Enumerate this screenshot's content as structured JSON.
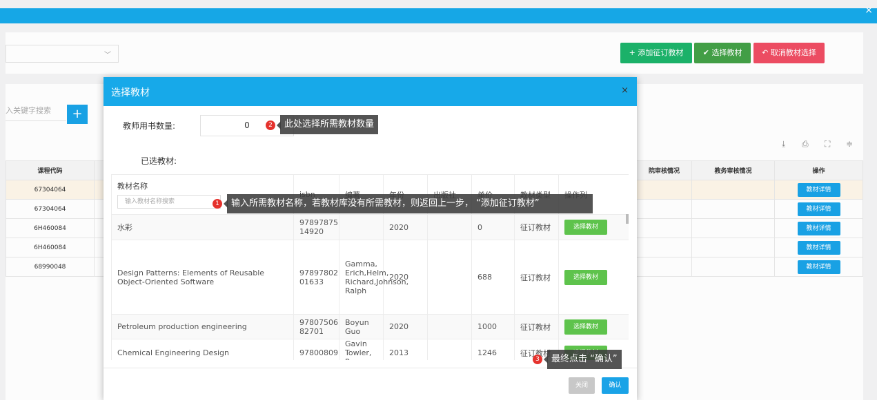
{
  "top": {
    "close_icon": "×"
  },
  "toolbar": {
    "add_label": "+ 添加征订教材",
    "select_label": "✔ 选择教材",
    "cancel_label": "↶ 取消教材选择"
  },
  "search": {
    "placeholder": "入关键字搜索",
    "add_icon": "+"
  },
  "bg_table": {
    "headers": {
      "code": "课程代码",
      "review1": "院审核情况",
      "review2": "教务审核情况",
      "action": "操作"
    },
    "rows": [
      {
        "code": "67304064",
        "action": "教材详情"
      },
      {
        "code": "67304064",
        "action": "教材详情"
      },
      {
        "code": "6H460084",
        "action": "教材详情"
      },
      {
        "code": "6H460084",
        "action": "教材详情"
      },
      {
        "code": "68990048",
        "action": "教材详情"
      }
    ]
  },
  "modal": {
    "title": "选择教材",
    "close": "×",
    "qty_label": "教师用书数量:",
    "qty_value": "0",
    "selected_label": "已选教材:",
    "columns": {
      "name": "教材名称",
      "isbn": "isbn",
      "editor": "编著",
      "year": "年份",
      "publisher": "出版社",
      "price": "单价",
      "type": "教材类型",
      "ops": "操作列"
    },
    "name_placeholder": "输入教材名称搜索",
    "rows": [
      {
        "name": "水彩",
        "isbn": "97897875 14920",
        "editor": "",
        "year": "2020",
        "publisher": "",
        "price": "0",
        "type": "征订教材",
        "action": "选择教材"
      },
      {
        "name": "Design Patterns: Elements of Reusable Object-Oriented Software",
        "isbn": "97897802 01633",
        "editor": "Gamma, Erich,Helm, Richard,Johnson, Ralph",
        "year": "2020",
        "publisher": "",
        "price": "688",
        "type": "征订教材",
        "action": "选择教材"
      },
      {
        "name": "Petroleum production engineering",
        "isbn": "97807506 82701",
        "editor": "Boyun Guo",
        "year": "2020",
        "publisher": "",
        "price": "1000",
        "type": "征订教材",
        "action": "选择教材"
      },
      {
        "name": "Chemical Engineering Design",
        "isbn": "97800809",
        "editor": "Gavin Towler, Ray",
        "year": "2013",
        "publisher": "",
        "price": "1246",
        "type": "征订教材",
        "action": "选择教材"
      }
    ],
    "footer": {
      "close": "关闭",
      "confirm": "确认"
    }
  },
  "tips": {
    "t1": {
      "num": "1",
      "text": "输入所需教材名称，若教材库没有所需教材，则返回上一步， “添加征订教材”"
    },
    "t2": {
      "num": "2",
      "text": "此处选择所需教材数量"
    },
    "t3": {
      "num": "3",
      "text": "最终点击 “确认”"
    }
  }
}
